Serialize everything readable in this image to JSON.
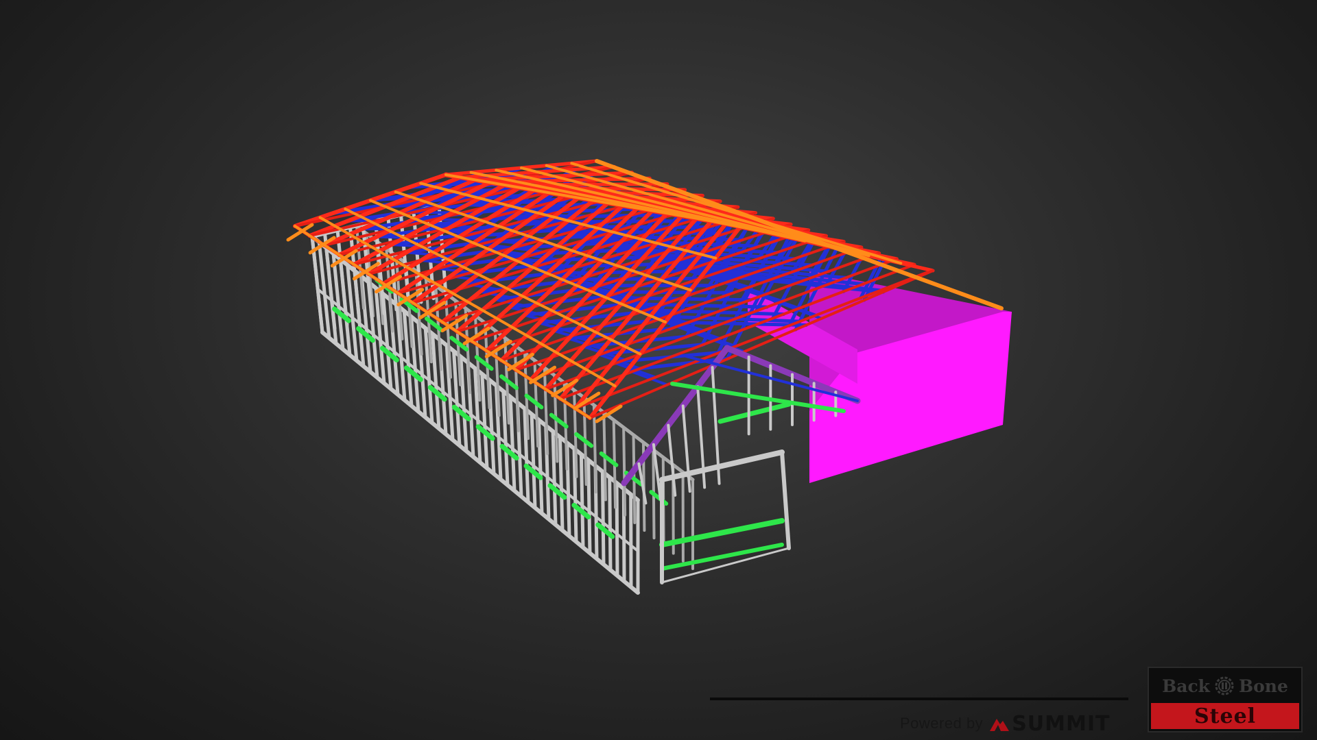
{
  "viewer": {
    "background": "#2f2f2f",
    "model_name": "",
    "member_colors": {
      "wall_frame": "#c9c9c9",
      "noggin": "#2ee64a",
      "truss_chord": "#ff2a1a",
      "truss_web": "#2230d8",
      "roof_batten": "#ff8c1a",
      "fascia": "#8a3ab8",
      "wall_cladding": "#ff1aff"
    }
  },
  "footer": {
    "powered_by": "Powered by",
    "brand": "SUMMIT",
    "brand_icon": "summit-mountain-icon"
  },
  "logo": {
    "top_left": "Back",
    "top_right": "Bone",
    "bottom": "Steel",
    "accent": "#c4161c",
    "icon": "gear-icon"
  }
}
